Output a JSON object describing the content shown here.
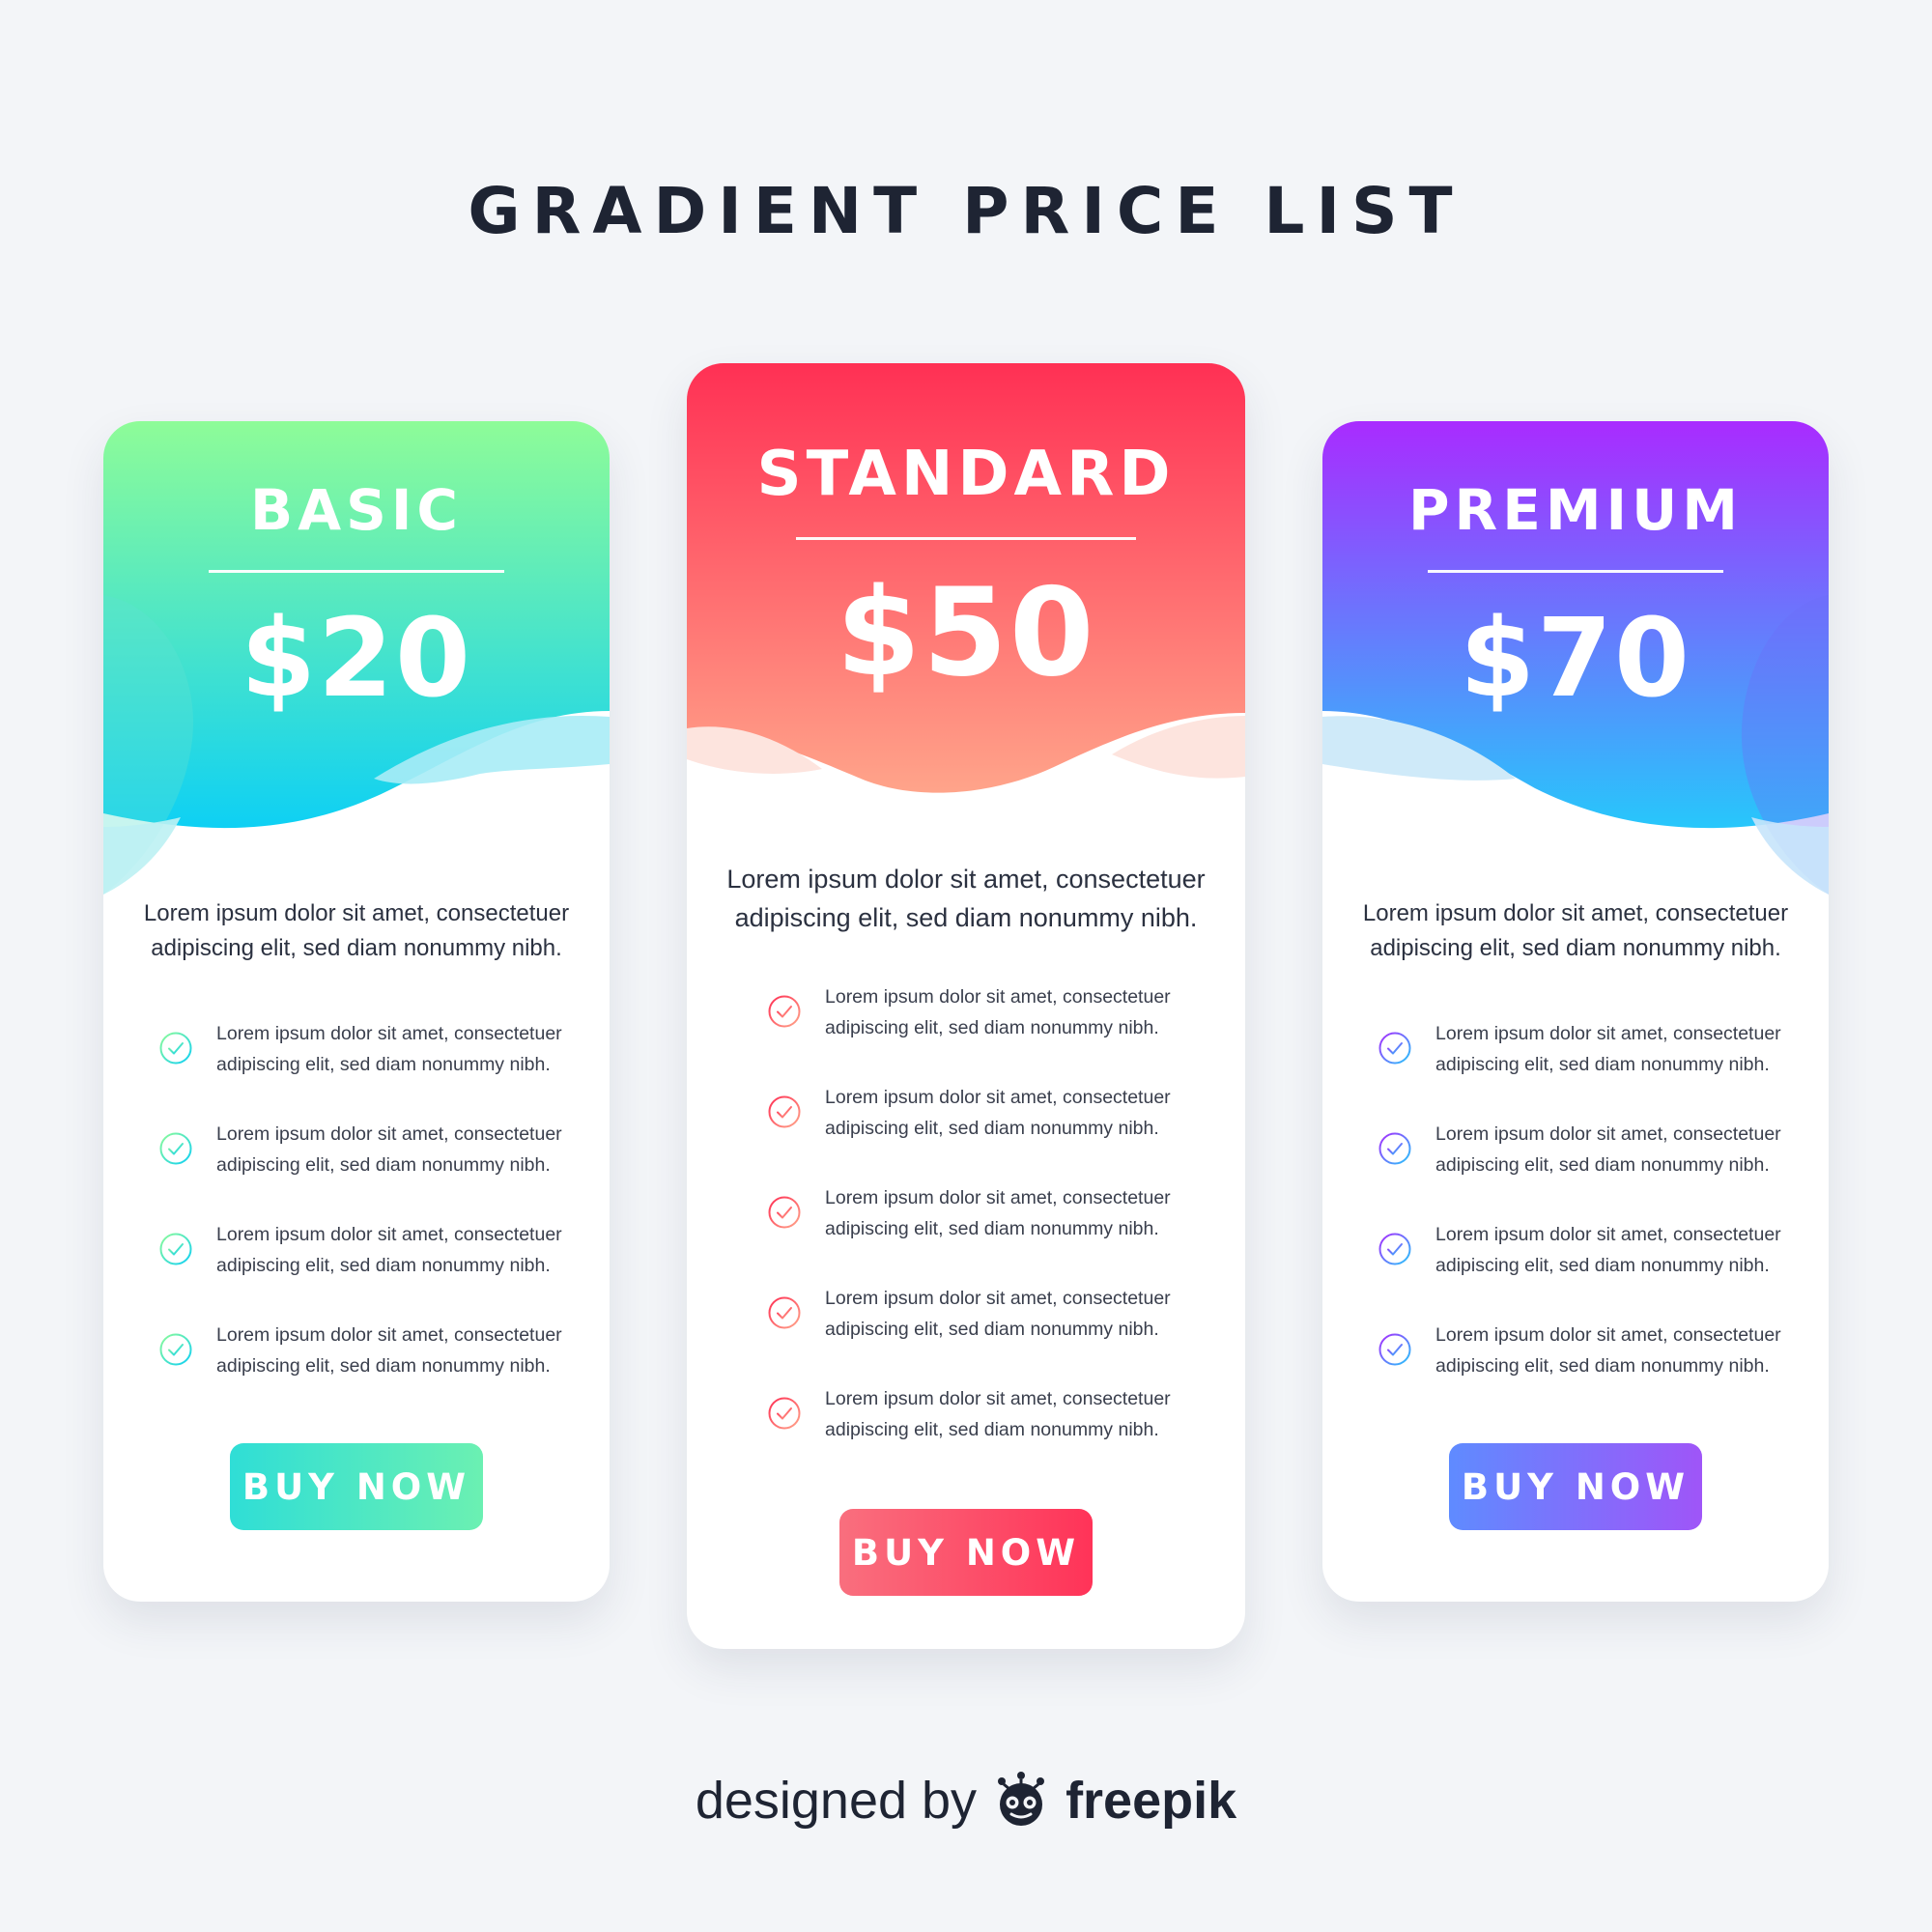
{
  "title": "GRADIENT PRICE LIST",
  "plans": [
    {
      "name": "BASIC",
      "price": "$20",
      "description": "Lorem ipsum dolor sit amet, consectetuer adipiscing elit, sed diam nonummy nibh.",
      "features": [
        "Lorem ipsum dolor sit amet, consectetuer adipiscing elit, sed diam nonummy nibh.",
        "Lorem ipsum dolor sit amet, consectetuer adipiscing elit, sed diam nonummy nibh.",
        "Lorem ipsum dolor sit amet, consectetuer adipiscing elit, sed diam nonummy nibh.",
        "Lorem ipsum dolor sit amet, consectetuer adipiscing elit, sed diam nonummy nibh."
      ],
      "button": "BUY NOW",
      "colors": {
        "top": "#8efc98",
        "bottom": "#0ed0f4",
        "check": "#36d9c9"
      }
    },
    {
      "name": "STANDARD",
      "price": "$50",
      "description": "Lorem ipsum dolor sit amet, consectetuer adipiscing elit, sed diam nonummy nibh.",
      "features": [
        "Lorem ipsum dolor sit amet, consectetuer adipiscing elit, sed diam nonummy nibh.",
        "Lorem ipsum dolor sit amet, consectetuer adipiscing elit, sed diam nonummy nibh.",
        "Lorem ipsum dolor sit amet, consectetuer adipiscing elit, sed diam nonummy nibh.",
        "Lorem ipsum dolor sit amet, consectetuer adipiscing elit, sed diam nonummy nibh.",
        "Lorem ipsum dolor sit amet, consectetuer adipiscing elit, sed diam nonummy nibh."
      ],
      "button": "BUY NOW",
      "colors": {
        "top": "#ff3054",
        "bottom": "#ffa48a",
        "check": "#f4546a"
      }
    },
    {
      "name": "PREMIUM",
      "price": "$70",
      "description": "Lorem ipsum dolor sit amet, consectetuer adipiscing elit, sed diam nonummy nibh.",
      "features": [
        "Lorem ipsum dolor sit amet, consectetuer adipiscing elit, sed diam nonummy nibh.",
        "Lorem ipsum dolor sit amet, consectetuer adipiscing elit, sed diam nonummy nibh.",
        "Lorem ipsum dolor sit amet, consectetuer adipiscing elit, sed diam nonummy nibh.",
        "Lorem ipsum dolor sit amet, consectetuer adipiscing elit, sed diam nonummy nibh."
      ],
      "button": "BUY NOW",
      "colors": {
        "top": "#a92bff",
        "bottom": "#27c7fb",
        "check": "#7a6df7"
      }
    }
  ],
  "footer": {
    "prefix": "designed by",
    "brand": "freepik"
  },
  "icons": {
    "feature": "check-circle-icon",
    "footer_logo": "freepik-logo-icon"
  }
}
